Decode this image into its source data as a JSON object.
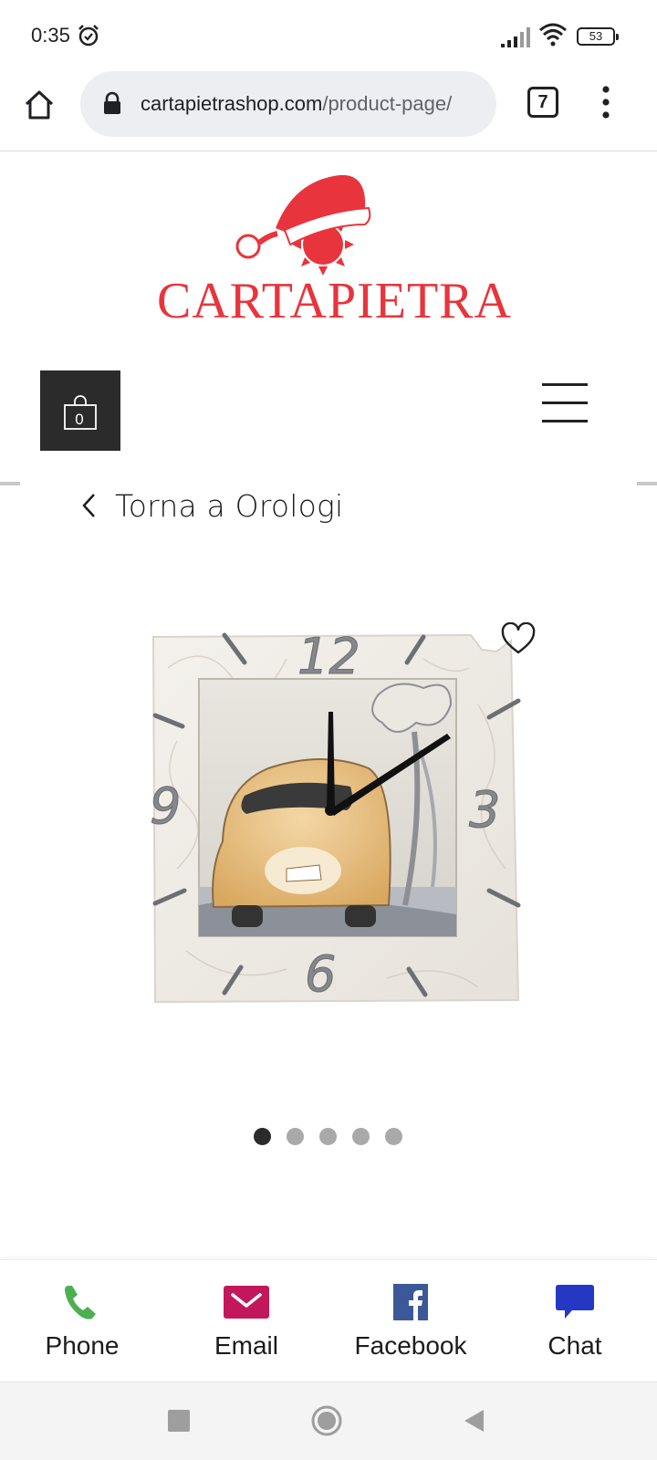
{
  "status_bar": {
    "time": "0:35",
    "battery": "53",
    "icons": [
      "alarm-icon",
      "signal-icon",
      "wifi-icon",
      "battery-icon"
    ]
  },
  "browser": {
    "url_domain": "cartapietrashop.com",
    "url_path": "/product-page/",
    "tab_count": "7",
    "icons": [
      "home-icon",
      "lock-icon",
      "more-vert-icon"
    ]
  },
  "site": {
    "logo_text": "CARTAPIETRA",
    "cart_count": "0",
    "icons": [
      "santa-hat-logo",
      "shopping-bag-icon",
      "hamburger-menu-icon"
    ],
    "colors": {
      "logo_red": "#e8343c",
      "cart_bg": "#2b2b2b"
    }
  },
  "navigation": {
    "back_label": "Torna a Orologi"
  },
  "product": {
    "image_description_icon": "clock-product-image",
    "clock_numerals": [
      "12",
      "3",
      "6",
      "9"
    ],
    "gallery_count": 5,
    "gallery_active_index": 0
  },
  "actions": [
    {
      "label": "Phone",
      "icon": "phone-icon",
      "color": "#4caf50"
    },
    {
      "label": "Email",
      "icon": "email-icon",
      "color": "#c2185b"
    },
    {
      "label": "Facebook",
      "icon": "facebook-icon",
      "color": "#3b5998"
    },
    {
      "label": "Chat",
      "icon": "chat-icon",
      "color": "#2438c4"
    }
  ],
  "system_nav": {
    "icons": [
      "recent-apps-icon",
      "home-circle-icon",
      "back-triangle-icon"
    ]
  }
}
